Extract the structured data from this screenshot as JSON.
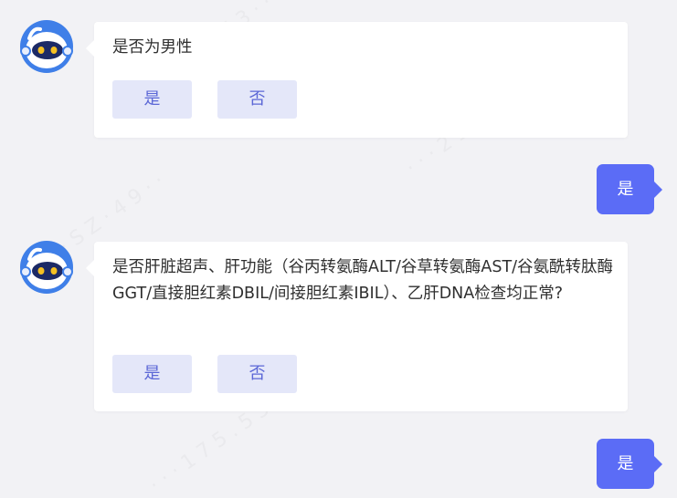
{
  "messages": [
    {
      "sender": "bot",
      "question": "是否为男性",
      "options": [
        "是",
        "否"
      ]
    },
    {
      "sender": "user",
      "answer": "是"
    },
    {
      "sender": "bot",
      "question": "是否肝脏超声、肝功能（谷丙转氨酶ALT/谷草转氨酶AST/谷氨酰转肽酶GGT/直接胆红素DBIL/间接胆红素IBIL）、乙肝DNA检查均正常?",
      "options": [
        "是",
        "否"
      ]
    },
    {
      "sender": "user",
      "answer": "是"
    }
  ],
  "avatar": {
    "icon": "robot-avatar-icon",
    "primary_color": "#3f7fe8",
    "visor_color": "#1c2a66"
  },
  "colors": {
    "background": "#f2f2f5",
    "user_bubble": "#5b6cf6",
    "option_bg": "#e4e7f9",
    "option_text": "#5b67d6"
  }
}
